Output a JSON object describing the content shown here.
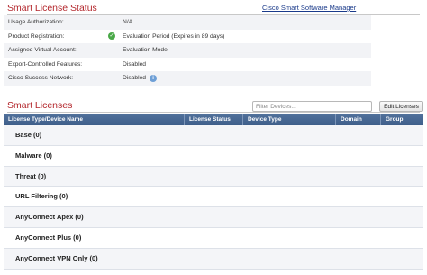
{
  "smart_license_status": {
    "title": "Smart License Status",
    "link_label": "Cisco Smart Software Manager",
    "rows": [
      {
        "label": "Usage Authorization:",
        "value": "N/A"
      },
      {
        "label": "Product Registration:",
        "value": "Evaluation Period (Expires in 89 days)",
        "icon": "check-icon"
      },
      {
        "label": "Assigned Virtual Account:",
        "value": "Evaluation Mode"
      },
      {
        "label": "Export-Controlled Features:",
        "value": "Disabled"
      },
      {
        "label": "Cisco Success Network:",
        "value": "Disabled",
        "icon": "info-icon"
      }
    ]
  },
  "smart_licenses": {
    "title": "Smart Licenses",
    "filter_placeholder": "Filter Devices...",
    "edit_button": "Edit Licenses",
    "columns": [
      "License Type/Device Name",
      "License Status",
      "Device Type",
      "Domain",
      "Group"
    ],
    "rows": [
      "Base (0)",
      "Malware (0)",
      "Threat (0)",
      "URL Filtering (0)",
      "AnyConnect Apex (0)",
      "AnyConnect Plus (0)",
      "AnyConnect VPN Only (0)"
    ]
  },
  "colors": {
    "section_title": "#b3262b",
    "table_header": "#4a6a96",
    "link": "#1a3a8a",
    "check": "#49a847",
    "info": "#6e9fd6"
  }
}
